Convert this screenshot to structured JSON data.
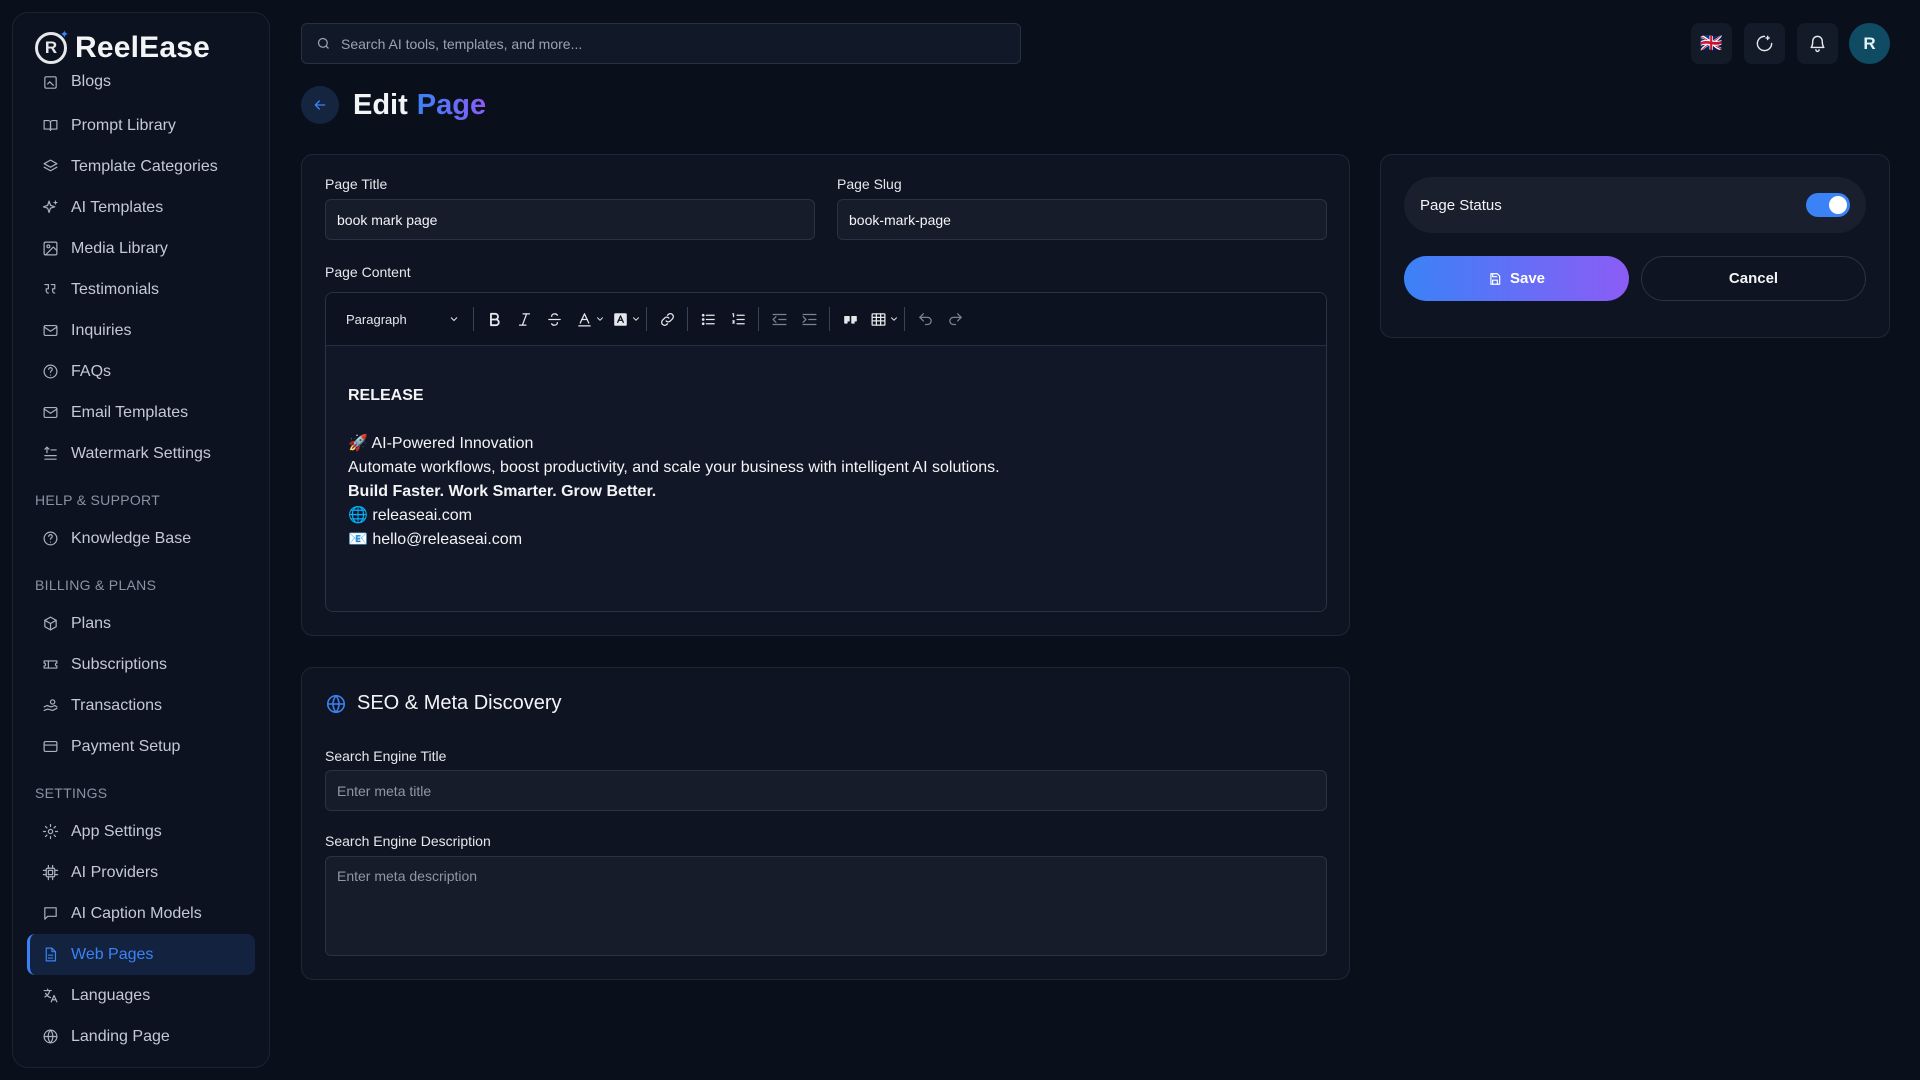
{
  "app": {
    "name": "ReelEase"
  },
  "sidebar": {
    "items_top": [
      {
        "label": "Blogs",
        "icon": "blog-icon"
      },
      {
        "label": "Prompt Library",
        "icon": "book-icon"
      },
      {
        "label": "Template Categories",
        "icon": "layers-icon"
      },
      {
        "label": "AI Templates",
        "icon": "sparkles-icon"
      },
      {
        "label": "Media Library",
        "icon": "image-icon"
      },
      {
        "label": "Testimonials",
        "icon": "quote-icon"
      },
      {
        "label": "Inquiries",
        "icon": "mail-icon"
      },
      {
        "label": "FAQs",
        "icon": "help-circle-icon"
      },
      {
        "label": "Email Templates",
        "icon": "mail-icon"
      },
      {
        "label": "Watermark Settings",
        "icon": "watermark-icon"
      }
    ],
    "section_help": "HELP & SUPPORT",
    "items_help": [
      {
        "label": "Knowledge Base",
        "icon": "help-circle-icon"
      }
    ],
    "section_billing": "BILLING & PLANS",
    "items_billing": [
      {
        "label": "Plans",
        "icon": "package-icon"
      },
      {
        "label": "Subscriptions",
        "icon": "ticket-icon"
      },
      {
        "label": "Transactions",
        "icon": "hand-coins-icon"
      },
      {
        "label": "Payment Setup",
        "icon": "credit-card-icon"
      }
    ],
    "section_settings": "SETTINGS",
    "items_settings": [
      {
        "label": "App Settings",
        "icon": "gear-icon"
      },
      {
        "label": "AI Providers",
        "icon": "cpu-icon"
      },
      {
        "label": "AI Caption Models",
        "icon": "message-square-icon"
      },
      {
        "label": "Web Pages",
        "icon": "file-text-icon",
        "active": true
      },
      {
        "label": "Languages",
        "icon": "languages-icon"
      },
      {
        "label": "Landing Page",
        "icon": "globe-icon"
      }
    ]
  },
  "topbar": {
    "search_placeholder": "Search AI tools, templates, and more...",
    "language_flag": "🇬🇧",
    "avatar_initial": "R"
  },
  "page": {
    "title_part1": "Edit",
    "title_part2": "Page"
  },
  "form": {
    "page_title_label": "Page Title",
    "page_title_value": "book mark page",
    "page_slug_label": "Page Slug",
    "page_slug_value": "book-mark-page",
    "page_content_label": "Page Content",
    "editor": {
      "block_type": "Paragraph",
      "heading": "RELEASE",
      "line1": "🚀 AI-Powered Innovation",
      "line2": "Automate workflows, boost productivity, and scale your business with intelligent AI solutions.",
      "line3": "Build Faster. Work Smarter. Grow Better.",
      "line4": "🌐 releaseai.com",
      "line5": "📧 hello@releaseai.com"
    }
  },
  "seo": {
    "heading": "SEO & Meta Discovery",
    "title_label": "Search Engine Title",
    "title_placeholder": "Enter meta title",
    "desc_label": "Search Engine Description",
    "desc_placeholder": "Enter meta description"
  },
  "status_panel": {
    "status_label": "Page Status",
    "status_on": true,
    "save_label": "Save",
    "cancel_label": "Cancel"
  },
  "colors": {
    "accent": "#3b82f6",
    "accent_gradient_end": "#8b5cf6",
    "background": "#0a0f1c"
  }
}
